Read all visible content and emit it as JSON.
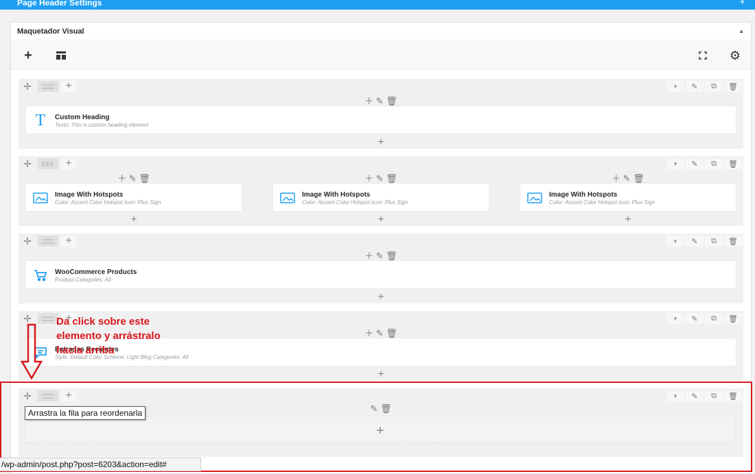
{
  "top_bar": {
    "title": "Page Header Settings"
  },
  "panel": {
    "title": "Maquetador Visual"
  },
  "rows": {
    "r1": {
      "element": {
        "name": "Custom Heading",
        "desc": "Texto: This is custom heading element",
        "icon": "text-icon"
      }
    },
    "r2": {
      "elements": [
        {
          "name": "Image With Hotspots",
          "desc": "Color: Accent Color  Hotspot Icon: Plus Sign",
          "icon": "image-icon"
        },
        {
          "name": "Image With Hotspots",
          "desc": "Color: Accent Color  Hotspot Icon: Plus Sign",
          "icon": "image-icon"
        },
        {
          "name": "Image With Hotspots",
          "desc": "Color: Accent Color  Hotspot Icon: Plus Sign",
          "icon": "image-icon"
        }
      ]
    },
    "r3": {
      "element": {
        "name": "WooCommerce Products",
        "desc": "Product Categories: All",
        "icon": "cart-icon"
      }
    },
    "r4": {
      "element": {
        "name": "Entradas Recientes",
        "desc": "Style: Default  Color Scheme: Light  Blog Categories: All",
        "icon": "chat-icon"
      }
    }
  },
  "annotation": {
    "line1": "Da click sobre este",
    "line2": "elemento y arrástralo",
    "line3": "hacia arriba"
  },
  "tooltip": "Arrastra la fila para reordenarla",
  "status_url": "/wp-admin/post.php?post=6203&action=edit#",
  "colors": {
    "accent": "#1e9ff2",
    "annotation": "#d9161b"
  }
}
